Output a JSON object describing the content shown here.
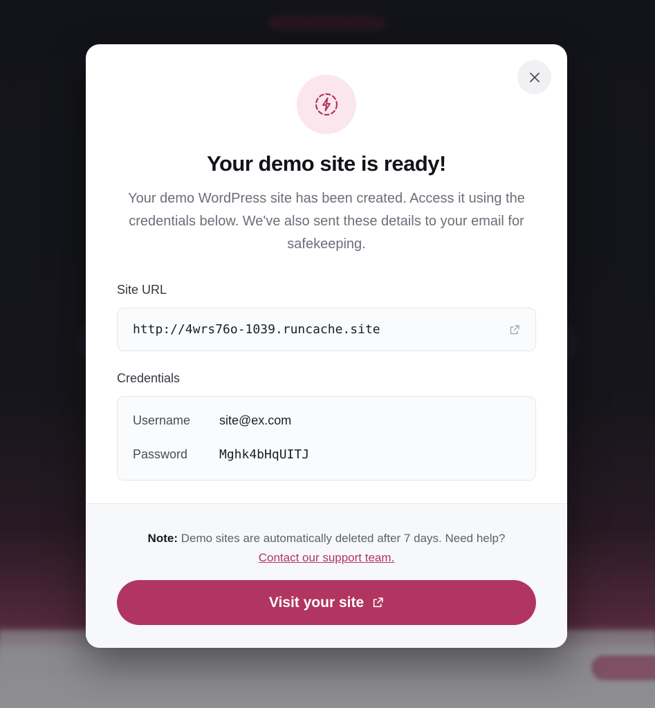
{
  "modal": {
    "title": "Your demo site is ready!",
    "description": "Your demo WordPress site has been created. Access it using the credentials below. We've also sent these details to your email for safekeeping.",
    "site_url_label": "Site URL",
    "site_url": "http://4wrs76o-1039.runcache.site",
    "credentials_label": "Credentials",
    "credentials": [
      {
        "key": "Username",
        "value": "site@ex.com"
      },
      {
        "key": "Password",
        "value": "Mghk4bHqUITJ"
      }
    ],
    "note_prefix": "Note:",
    "note_text": " Demo sites are automatically deleted after 7 days. Need help?",
    "support_link": "Contact our support team.",
    "visit_button": "Visit your site",
    "icons": {
      "close": "close-icon",
      "badge": "lightning-icon",
      "external": "external-link-icon"
    }
  },
  "colors": {
    "accent": "#b03560",
    "badge_bg": "#fbe6ee"
  }
}
